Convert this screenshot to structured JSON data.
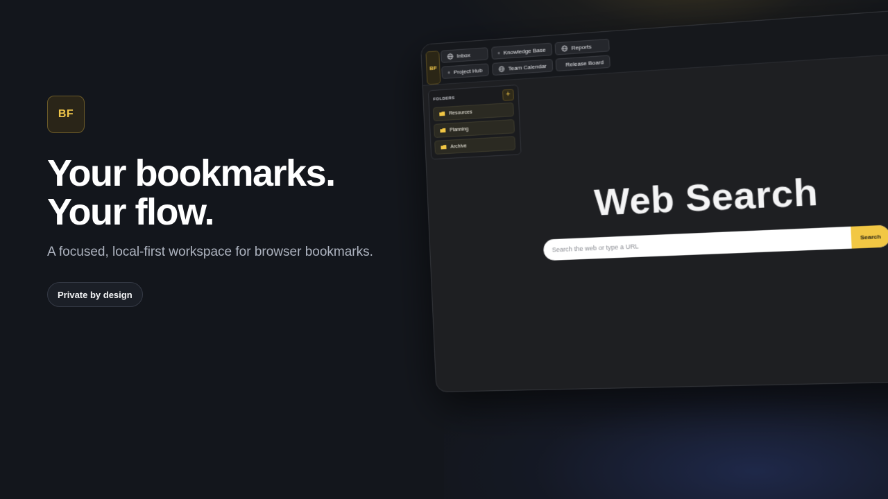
{
  "hero": {
    "logo_text": "BF",
    "headline_line1": "Your bookmarks.",
    "headline_line2": "Your flow.",
    "subtitle": "A focused, local-first workspace for browser bookmarks.",
    "pill_label": "Private by design"
  },
  "mock": {
    "logo_text": "BF",
    "tabs_row1": [
      "Inbox",
      "Knowledge Base",
      "Reports"
    ],
    "tabs_row2": [
      "Project Hub",
      "Team Calendar",
      "Release Board"
    ],
    "folders": {
      "title": "FOLDERS",
      "add_label": "+",
      "items": [
        "Resources",
        "Planning",
        "Archive"
      ]
    },
    "search": {
      "title": "Web Search",
      "placeholder": "Search the web or type a URL",
      "button_label": "Search"
    }
  },
  "colors": {
    "accent": "#f2c744",
    "background": "#13161c",
    "panel": "#1e1f22"
  },
  "icons": {
    "tab_icon": "globe-icon",
    "folder_icon": "folder-icon",
    "add_icon": "plus-icon"
  }
}
